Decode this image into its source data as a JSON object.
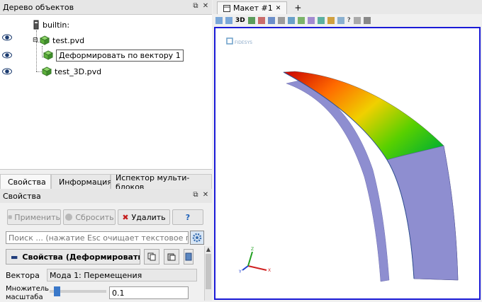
{
  "pipeline": {
    "title": "Дерево объектов",
    "items": [
      {
        "label": "builtin:"
      },
      {
        "label": "test.pvd"
      },
      {
        "label": "Деформировать по вектору 1"
      },
      {
        "label": "test_3D.pvd"
      }
    ]
  },
  "tabs": [
    {
      "label": "Свойства"
    },
    {
      "label": "Информация"
    },
    {
      "label": "Испектор мульти-блоков"
    }
  ],
  "properties": {
    "title": "Свойства",
    "apply_label": "Применить",
    "reset_label": "Сбросить",
    "delete_label": "Удалить",
    "help_label": "?",
    "search_placeholder": "Поиск ... (нажатие Esc очищает текстовое поле)",
    "section_label": "Свойства (Деформировать п",
    "vectors_label": "Вектора",
    "vectors_value": "Мода 1: Перемещения",
    "scale_label": "Множитель масштаба",
    "scale_value": "0.1",
    "scale_slider_fraction": 0.08
  },
  "view": {
    "tab_label": "Макет #1",
    "new_tab_label": "+",
    "mode_3d": "3D",
    "logo_text": "FIDESYS",
    "axes": {
      "x": "X",
      "y": "Y",
      "z": "Z"
    }
  },
  "colors": {
    "viewport_border": "#1a1ad6",
    "delete_x": "#c41e1e",
    "surface_gray": "#8e8ed0"
  }
}
